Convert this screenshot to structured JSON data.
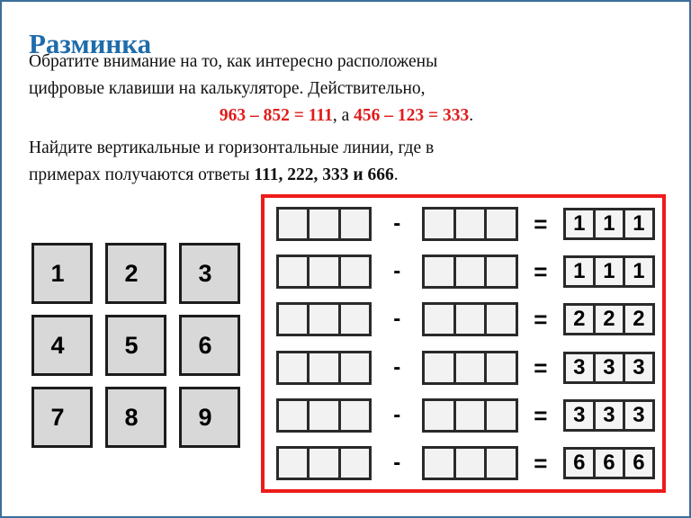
{
  "slide": {
    "title": "Разминка",
    "border_color": "#3b6e9c",
    "title_color": "#1f6cab",
    "accent_red": "#e01b1b",
    "panel_border_color": "#ee1b1b"
  },
  "text": {
    "paragraph1_line1": "Обратите внимание на то, как интересно расположены",
    "paragraph1_line2": "цифровые клавиши на калькуляторе.  Действительно,",
    "formula": {
      "expr1": "963 – 852 = 111",
      "conjunction": ", а ",
      "expr2": "456 – 123 = 333",
      "period": "."
    },
    "paragraph2_line1": "Найдите вертикальные и горизонтальные линии, где в",
    "paragraph2_line2_prefix": "примерах получаются ответы ",
    "paragraph2_line2_bold": "111, 222, 333 и 666",
    "paragraph2_line2_suffix": "."
  },
  "keypad": {
    "keys": [
      "1",
      "2",
      "3",
      "4",
      "5",
      "6",
      "7",
      "8",
      "9"
    ]
  },
  "equations": {
    "minus_symbol": "-",
    "equals_symbol": "=",
    "rows": [
      {
        "minuend": [
          "",
          "",
          ""
        ],
        "subtrahend": [
          "",
          "",
          ""
        ],
        "answer": [
          "1",
          "1",
          "1"
        ]
      },
      {
        "minuend": [
          "",
          "",
          ""
        ],
        "subtrahend": [
          "",
          "",
          ""
        ],
        "answer": [
          "1",
          "1",
          "1"
        ]
      },
      {
        "minuend": [
          "",
          "",
          ""
        ],
        "subtrahend": [
          "",
          "",
          ""
        ],
        "answer": [
          "2",
          "2",
          "2"
        ]
      },
      {
        "minuend": [
          "",
          "",
          ""
        ],
        "subtrahend": [
          "",
          "",
          ""
        ],
        "answer": [
          "3",
          "3",
          "3"
        ]
      },
      {
        "minuend": [
          "",
          "",
          ""
        ],
        "subtrahend": [
          "",
          "",
          ""
        ],
        "answer": [
          "3",
          "3",
          "3"
        ]
      },
      {
        "minuend": [
          "",
          "",
          ""
        ],
        "subtrahend": [
          "",
          "",
          ""
        ],
        "answer": [
          "6",
          "6",
          "6"
        ]
      }
    ]
  }
}
